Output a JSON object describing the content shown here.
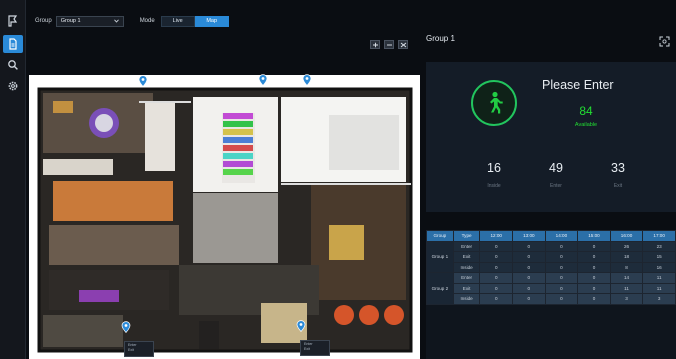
{
  "colors": {
    "accent": "#2a8ad8",
    "enter_green": "#22c55e",
    "table_header": "#2b6fa8"
  },
  "sidebar": {
    "items": [
      {
        "name": "logo-icon",
        "active": false
      },
      {
        "name": "document-icon",
        "active": true
      },
      {
        "name": "search-icon",
        "active": false
      },
      {
        "name": "gear-icon",
        "active": false
      }
    ]
  },
  "toolbar": {
    "group_label": "Group",
    "group_value": "Group 1",
    "mode_label": "Mode",
    "live_label": "Live",
    "map_label": "Map"
  },
  "map": {
    "cameras": [
      {
        "popup_line1": "Enter",
        "popup_line2": "Exit"
      },
      {
        "popup_line1": "Enter",
        "popup_line2": "Exit"
      }
    ]
  },
  "panel": {
    "title": "Group 1",
    "status": "Please Enter",
    "available": "84",
    "available_label": "Available",
    "stats": [
      {
        "value": "16",
        "label": "Inside"
      },
      {
        "value": "49",
        "label": "Enter"
      },
      {
        "value": "33",
        "label": "Exit"
      }
    ]
  },
  "table": {
    "headers": [
      "Group",
      "Type",
      "12:00",
      "13:00",
      "14:00",
      "15:00",
      "16:00",
      "17:00"
    ],
    "groups": [
      {
        "name": "Group 1",
        "rows": [
          {
            "type": "Enter",
            "values": [
              "0",
              "0",
              "0",
              "0",
              "26",
              "23"
            ]
          },
          {
            "type": "Exit",
            "values": [
              "0",
              "0",
              "0",
              "0",
              "18",
              "15"
            ]
          },
          {
            "type": "Inside",
            "values": [
              "0",
              "0",
              "0",
              "0",
              "8",
              "16"
            ]
          }
        ]
      },
      {
        "name": "Group 2",
        "rows": [
          {
            "type": "Enter",
            "values": [
              "0",
              "0",
              "0",
              "0",
              "14",
              "11"
            ]
          },
          {
            "type": "Exit",
            "values": [
              "0",
              "0",
              "0",
              "0",
              "11",
              "11"
            ]
          },
          {
            "type": "Inside",
            "values": [
              "0",
              "0",
              "0",
              "0",
              "3",
              "3"
            ]
          }
        ]
      }
    ]
  }
}
